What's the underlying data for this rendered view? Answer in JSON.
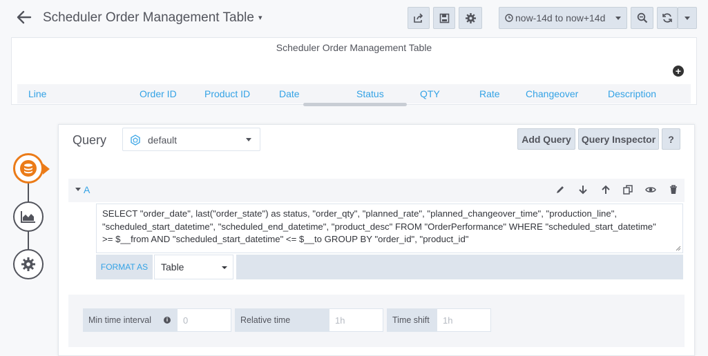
{
  "header": {
    "title": "Scheduler Order Management Table",
    "time_range": "now-14d to now+14d"
  },
  "panel": {
    "title": "Scheduler Order Management Table",
    "columns": [
      "Line",
      "Order ID",
      "Product ID",
      "Date",
      "Status",
      "QTY",
      "Rate",
      "Changeover",
      "Description"
    ]
  },
  "editor": {
    "query_label": "Query",
    "datasource": "default",
    "add_query": "Add Query",
    "query_inspector": "Query Inspector",
    "help": "?",
    "ref_id": "A",
    "sql_lines": [
      "SELECT \"order_date\", last(\"order_state\") as status, \"order_qty\", \"planned_rate\", \"planned_changeover_time\", \"production_line\",",
      "\"scheduled_start_datetime\", \"scheduled_end_datetime\", \"product_desc\" FROM \"OrderPerformance\" WHERE \"scheduled_start_datetime\"",
      ">= $__from AND \"scheduled_start_datetime\" <= $__to GROUP BY \"order_id\", \"product_id\""
    ],
    "format_as_label": "FORMAT AS",
    "format_as_value": "Table",
    "min_interval_label": "Min time interval",
    "min_interval_placeholder": "0",
    "relative_time_label": "Relative time",
    "relative_time_placeholder": "1h",
    "time_shift_label": "Time shift",
    "time_shift_placeholder": "1h"
  },
  "colors": {
    "accent_blue": "#33a2e5",
    "active_orange": "#eb7b18",
    "button_bg": "#dde4ed"
  }
}
